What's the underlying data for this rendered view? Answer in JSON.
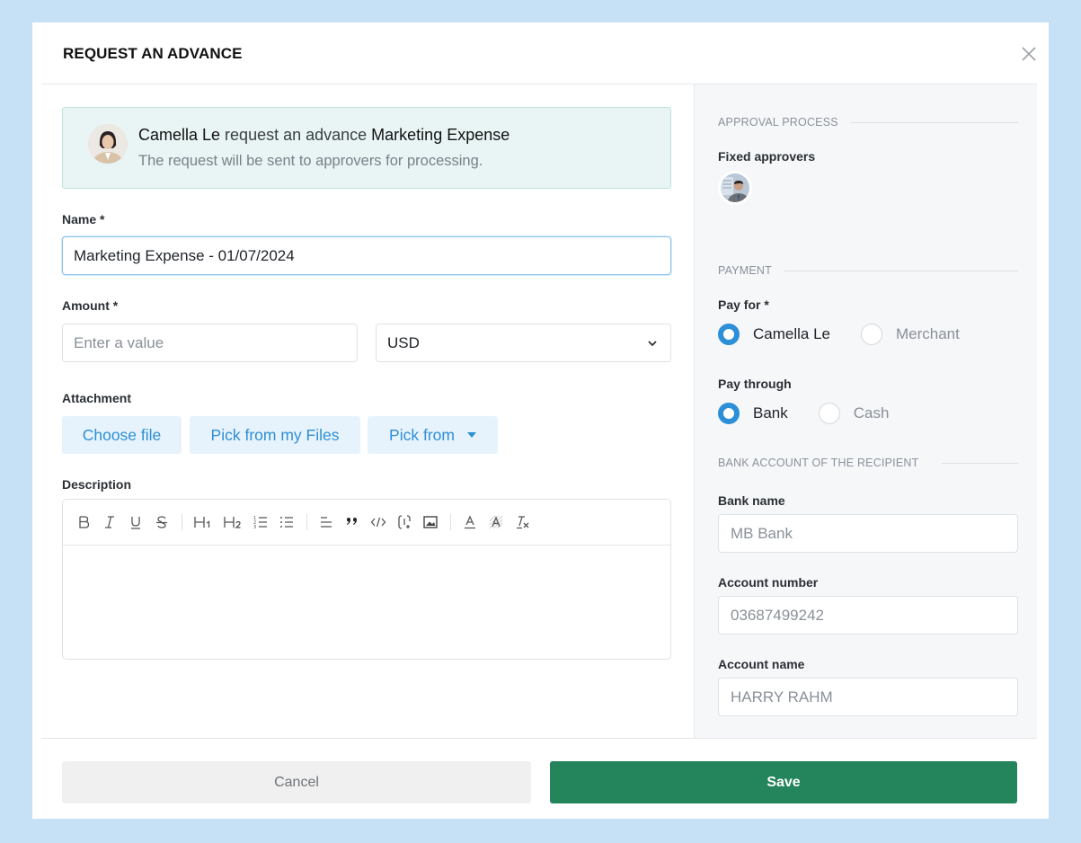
{
  "modal": {
    "title": "REQUEST AN ADVANCE",
    "close_icon": "close-icon"
  },
  "banner": {
    "requester": "Camella Le",
    "middle_text": " request an advance ",
    "expense_name": "Marketing Expense",
    "subtitle": "The request will be sent to approvers for processing."
  },
  "form": {
    "name_label": "Name *",
    "name_value": "Marketing Expense - 01/07/2024",
    "amount_label": "Amount *",
    "amount_placeholder": "Enter a value",
    "currency_value": "USD",
    "attachment_label": "Attachment",
    "attachment_buttons": {
      "choose_file": "Choose file",
      "pick_my_files": "Pick from my Files",
      "pick_from": "Pick from"
    },
    "description_label": "Description",
    "description_value": "",
    "toolbar": [
      "bold",
      "italic",
      "underline",
      "strikethrough",
      "heading-1",
      "heading-2",
      "ordered-list",
      "bullet-list",
      "horizontal-rule",
      "blockquote",
      "code",
      "insert-field",
      "image",
      "text-color",
      "highlight",
      "clear-format"
    ]
  },
  "right_panel": {
    "approval_section": "APPROVAL PROCESS",
    "fixed_approvers_label": "Fixed approvers",
    "payment_section": "PAYMENT",
    "pay_for_label": "Pay for *",
    "pay_for_options": [
      {
        "label": "Camella Le",
        "selected": true
      },
      {
        "label": "Merchant",
        "selected": false
      }
    ],
    "pay_through_label": "Pay through",
    "pay_through_options": [
      {
        "label": "Bank",
        "selected": true
      },
      {
        "label": "Cash",
        "selected": false
      }
    ],
    "bank_section": "BANK ACCOUNT OF THE RECIPIENT",
    "bank_name_label": "Bank name",
    "bank_name_value": "MB Bank",
    "account_number_label": "Account number",
    "account_number_value": "03687499242",
    "account_name_label": "Account name",
    "account_name_value": "HARRY RAHM"
  },
  "footer": {
    "cancel_label": "Cancel",
    "save_label": "Save"
  },
  "colors": {
    "background": "#c6e0f6",
    "accent_blue": "#2d8fd8",
    "save_green": "#24845c",
    "banner_bg": "#e8f5f4"
  }
}
